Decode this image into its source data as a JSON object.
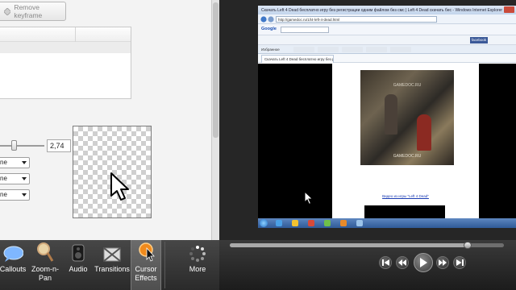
{
  "left_panel": {
    "remove_keyframe_label": "Remove keyframe",
    "slider_value": "2,74",
    "dropdowns": [
      "ne",
      "ne",
      "ne"
    ]
  },
  "toolbar": {
    "tools": [
      {
        "label": "Callouts",
        "icon": "callout-bubble-icon"
      },
      {
        "label": "Zoom-n-Pan",
        "icon": "magnifier-icon"
      },
      {
        "label": "Audio",
        "icon": "speaker-icon"
      },
      {
        "label": "Transitions",
        "icon": "transitions-icon"
      },
      {
        "label": "Cursor Effects",
        "icon": "cursor-effects-icon",
        "selected": true
      },
      {
        "label": "More",
        "icon": "more-spinner-icon"
      }
    ]
  },
  "screen": {
    "window_title": "Скачать Left 4 Dead бесплатно игру без регистрации одним файлом без смс | Left 4 Dead скачать бес - Windows Internet Explorer",
    "address": "http://gamedoc.ru/1/l4-left-4-dead.html",
    "search_engine": "Google",
    "tab_title": "Скачать Left 4 Dead бесплатно игру без регист...",
    "favorites_label": "Избранное",
    "facebook_label": "facebook",
    "watermark_top": "GAMEDOC.RU",
    "watermark_bottom": "GAMEDOC.RU",
    "link_text": "Видео из игры \"Left 4 Dead\""
  },
  "player": {
    "progress_fraction": 0.86
  },
  "colors": {
    "toolbar_bg": "#2f2f2f",
    "cursor_effects_accent": "#f08a1c",
    "ie_taskbar": "#3b66a8"
  }
}
